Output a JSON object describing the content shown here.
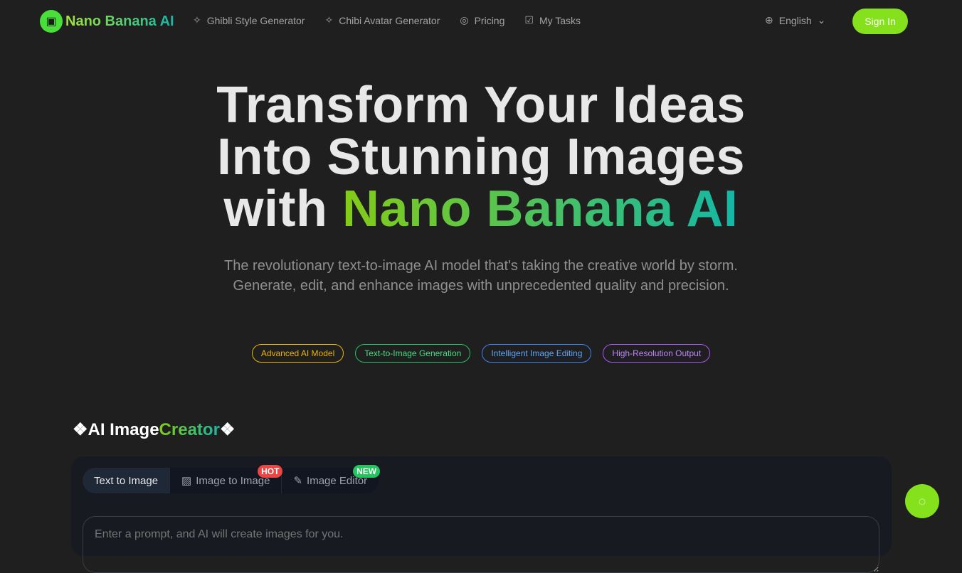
{
  "nav": {
    "brand": "Nano Banana AI",
    "links": [
      {
        "label": "Ghibli Style Generator",
        "icon": "sparkles-icon"
      },
      {
        "label": "Chibi Avatar Generator",
        "icon": "sparkles-icon"
      },
      {
        "label": "Pricing",
        "icon": "coin-icon"
      },
      {
        "label": "My Tasks",
        "icon": "checkbox-icon"
      }
    ],
    "language": "English",
    "sign_in": "Sign In"
  },
  "hero": {
    "line1": "Transform Your Ideas",
    "line2": "Into Stunning Images",
    "line3_prefix": "with ",
    "line3_brand": "Nano Banana AI",
    "subtitle": "The revolutionary text-to-image AI model that's taking the creative world by storm. Generate, edit, and enhance images with unprecedented quality and precision.",
    "tags": [
      {
        "label": "Advanced AI Model",
        "color": "#eab308"
      },
      {
        "label": "Text-to-Image Generation",
        "color": "#22c55e"
      },
      {
        "label": "Intelligent Image Editing",
        "color": "#3b82f6"
      },
      {
        "label": "High-Resolution Output",
        "color": "#a855f7"
      }
    ]
  },
  "creator": {
    "title_a": "AI Image",
    "title_b": "Creator",
    "tabs": [
      {
        "label": "Text to Image"
      },
      {
        "label": "Image to Image",
        "badge": "HOT",
        "badge_color": "#ef4444"
      },
      {
        "label": "Image Editor",
        "badge": "NEW",
        "badge_color": "#22c55e"
      }
    ],
    "prompt_placeholder": "Enter a prompt, and AI will create images for you."
  }
}
